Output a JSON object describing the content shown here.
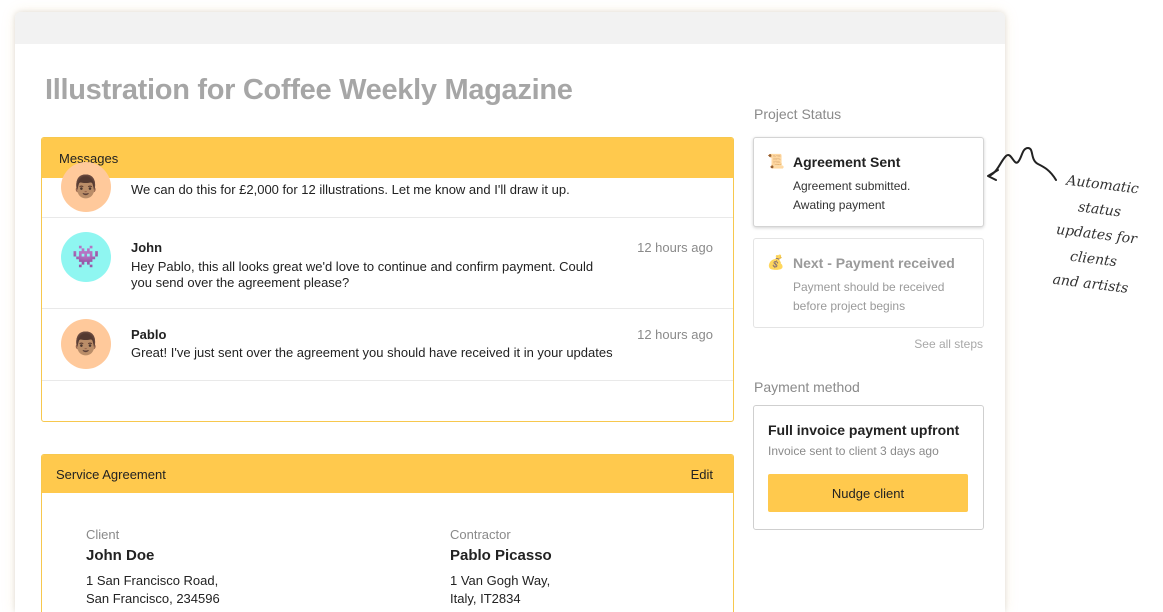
{
  "page": {
    "title": "Illustration for Coffee Weekly Magazine"
  },
  "messages": {
    "header": "Messages",
    "items": [
      {
        "name": "",
        "time": "",
        "text": "We can do this for £2,000 for 12 illustrations. Let me know and I'll draw it up.",
        "avatar": "man-face-icon"
      },
      {
        "name": "John",
        "time": "12 hours ago",
        "text": "Hey Pablo, this all looks great we'd love to continue and confirm payment. Could you send over the agreement please?",
        "avatar": "alien-monster-icon"
      },
      {
        "name": "Pablo",
        "time": "12 hours ago",
        "text": "Great! I've just sent over the agreement you should have received it in your updates",
        "avatar": "man-face-icon"
      }
    ]
  },
  "agreement": {
    "header": "Service Agreement",
    "edit_label": "Edit",
    "client": {
      "label": "Client",
      "name": "John Doe",
      "address_line1": "1 San Francisco Road,",
      "address_line2": "San Francisco, 234596"
    },
    "contractor": {
      "label": "Contractor",
      "name": "Pablo Picasso",
      "address_line1": "1 Van Gogh Way,",
      "address_line2": "Italy, IT2834"
    }
  },
  "project_status": {
    "title": "Project Status",
    "current": {
      "icon": "scroll-icon",
      "title": "Agreement Sent",
      "desc_line1": "Agreement submitted.",
      "desc_line2": "Awating payment"
    },
    "next": {
      "icon": "money-bag-icon",
      "title": "Next - Payment received",
      "desc_line1": "Payment should be received",
      "desc_line2": "before project begins"
    },
    "see_all": "See all steps"
  },
  "payment": {
    "title": "Payment method",
    "card_title": "Full invoice  payment upfront",
    "card_sub": "Invoice sent to client 3 days ago",
    "button": "Nudge client"
  },
  "annotation": {
    "line1": "Automatic status",
    "line2": "updates for clients",
    "line3": "and artists"
  }
}
